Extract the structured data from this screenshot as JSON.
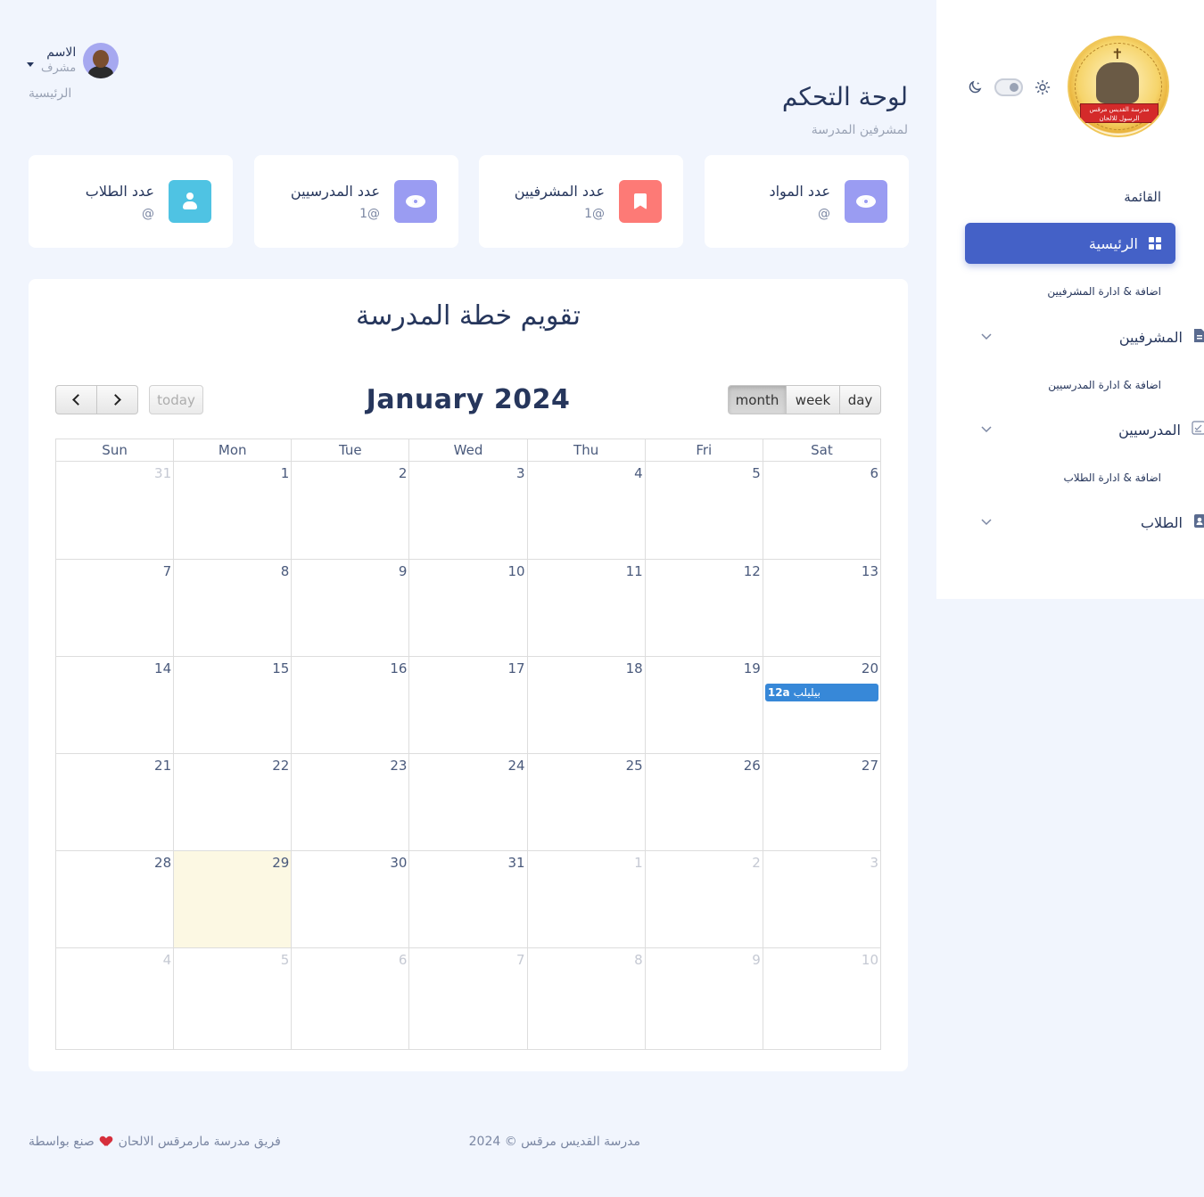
{
  "sidebar": {
    "menu_title": "القائمة",
    "active_item": "الرئيسية",
    "sections": [
      {
        "label": "اضافة & ادارة المشرفيين",
        "item": "المشرفيين",
        "icon": "document-icon"
      },
      {
        "label": "اضافة & ادارة المدرسيين",
        "item": "المدرسيين",
        "icon": "checklist-icon"
      },
      {
        "label": "اضافة & ادارة الطلاب",
        "item": "الطلاب",
        "icon": "contact-book-icon"
      }
    ],
    "logo_text": "مدرسة القديس مرقس الرسول للالحان"
  },
  "header": {
    "user_name": "الاسم",
    "user_role": "مشرف",
    "breadcrumb": "الرئيسية",
    "page_title": "لوحة التحكم",
    "page_subtitle": "لمشرفين المدرسة"
  },
  "stats": [
    {
      "title": "عدد الطلاب",
      "value": "@",
      "color": "#4fc3e3",
      "icon": "person-icon"
    },
    {
      "title": "عدد المدرسيين",
      "value": "1@",
      "color": "#9a9cf2",
      "icon": "eye-icon"
    },
    {
      "title": "عدد المشرفيين",
      "value": "1@",
      "color": "#fd7a76",
      "icon": "bookmark-icon"
    },
    {
      "title": "عدد المواد",
      "value": "@",
      "color": "#9a9cf2",
      "icon": "eye-icon"
    }
  ],
  "calendar": {
    "title": "تقويم خطة المدرسة",
    "month_label": "January 2024",
    "today_label": "today",
    "views": [
      "month",
      "week",
      "day"
    ],
    "active_view": "month",
    "weekdays": [
      "Sun",
      "Mon",
      "Tue",
      "Wed",
      "Thu",
      "Fri",
      "Sat"
    ],
    "weeks": [
      [
        "31",
        "1",
        "2",
        "3",
        "4",
        "5",
        "6"
      ],
      [
        "7",
        "8",
        "9",
        "10",
        "11",
        "12",
        "13"
      ],
      [
        "14",
        "15",
        "16",
        "17",
        "18",
        "19",
        "20"
      ],
      [
        "21",
        "22",
        "23",
        "24",
        "25",
        "26",
        "27"
      ],
      [
        "28",
        "29",
        "30",
        "31",
        "1",
        "2",
        "3"
      ],
      [
        "4",
        "5",
        "6",
        "7",
        "8",
        "9",
        "10"
      ]
    ],
    "event": {
      "time": "12a",
      "title": "بيليلب",
      "color": "#3788d8"
    },
    "today_highlight": "#fcf8e3"
  },
  "footer": {
    "credit_prefix": "صنع بواسطة",
    "credit_team": "فريق مدرسة مارمرقس الالحان",
    "copyright": "2024 © مدرسة القديس مرقس"
  }
}
